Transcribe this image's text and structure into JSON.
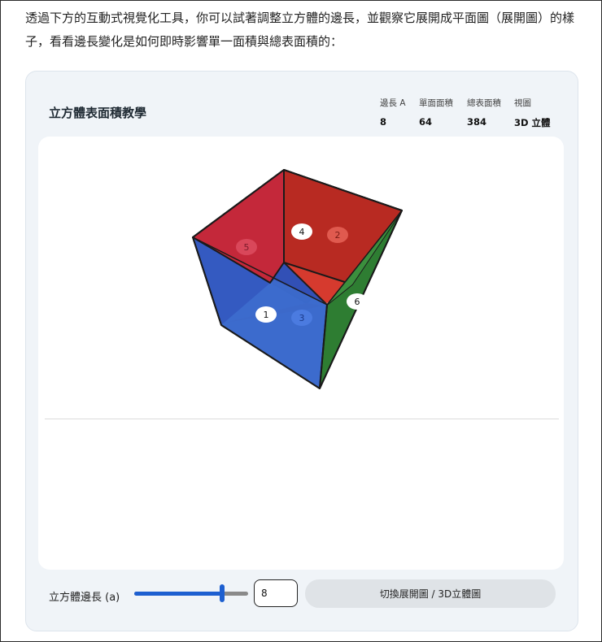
{
  "intro_text": "透過下方的互動式視覺化工具，你可以試著調整立方體的邊長，並觀察它展開成平面圖（展開圖）的樣子，看看邊長變化是如何即時影響單一面積與總表面積的：",
  "card": {
    "title": "立方體表面積教學",
    "stats": [
      {
        "label": "邊長 A",
        "value": "8"
      },
      {
        "label": "單面面積",
        "value": "64"
      },
      {
        "label": "總表面積",
        "value": "384"
      },
      {
        "label": "視圖",
        "value": "3D 立體"
      }
    ]
  },
  "cube": {
    "face_labels": [
      "1",
      "2",
      "3",
      "4",
      "5",
      "6"
    ],
    "colors": {
      "red": "#c0262c",
      "blue": "#2a52be",
      "green": "#2e7d32"
    }
  },
  "controls": {
    "edge_label": "立方體邊長 (a)",
    "slider_fraction": 0.77,
    "edge_value": "8",
    "toggle_label": "切換展開圖 / 3D立體圖"
  }
}
